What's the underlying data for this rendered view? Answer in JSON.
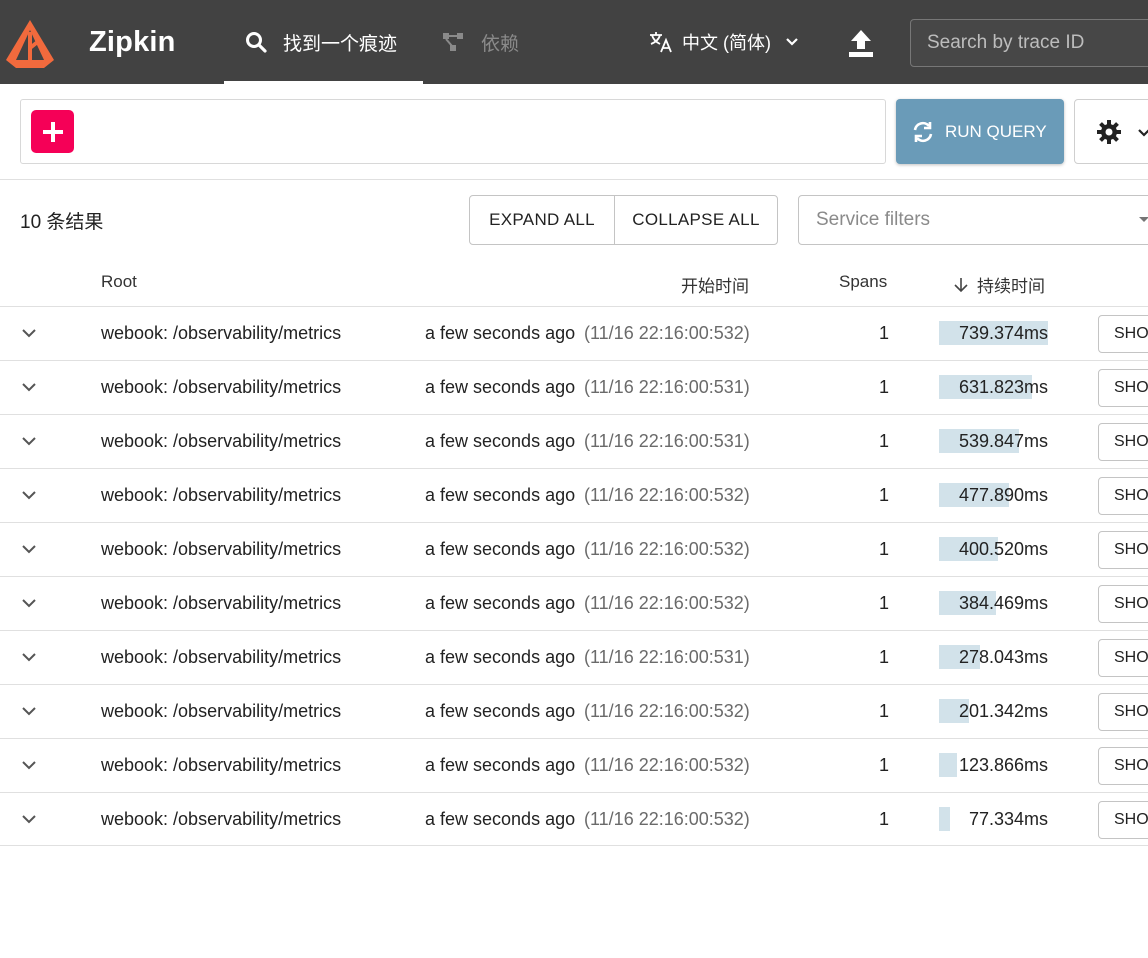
{
  "app": {
    "name": "Zipkin",
    "logo_icon": "zipkin-logo-icon"
  },
  "nav": {
    "tabs": [
      {
        "label": "找到一个痕迹",
        "icon": "search-icon",
        "active": true
      },
      {
        "label": "依赖",
        "icon": "dependencies-icon",
        "active": false
      }
    ],
    "language": {
      "label": "中文 (简体)",
      "icon": "translate-icon"
    },
    "upload_icon": "upload-icon",
    "search": {
      "placeholder": "Search by trace ID",
      "value": ""
    }
  },
  "query": {
    "add_icon": "plus-icon",
    "run_label": "RUN QUERY",
    "run_icon": "refresh-icon",
    "settings_icon": "gear-icon"
  },
  "results": {
    "count_label": "10 条结果",
    "expand_all": "EXPAND ALL",
    "collapse_all": "COLLAPSE ALL",
    "service_filter_placeholder": "Service filters"
  },
  "table": {
    "headers": {
      "root": "Root",
      "start_time": "开始时间",
      "spans": "Spans",
      "duration": "持续时间"
    },
    "sort_icon": "arrow-down-icon",
    "show_label": "SHOW",
    "rows": [
      {
        "root": "webook: /observability/metrics",
        "relative": "a few seconds ago",
        "absolute": "(11/16 22:16:00:532)",
        "spans": "1",
        "duration": "739.374ms",
        "duration_ms": 739.374
      },
      {
        "root": "webook: /observability/metrics",
        "relative": "a few seconds ago",
        "absolute": "(11/16 22:16:00:531)",
        "spans": "1",
        "duration": "631.823ms",
        "duration_ms": 631.823
      },
      {
        "root": "webook: /observability/metrics",
        "relative": "a few seconds ago",
        "absolute": "(11/16 22:16:00:531)",
        "spans": "1",
        "duration": "539.847ms",
        "duration_ms": 539.847
      },
      {
        "root": "webook: /observability/metrics",
        "relative": "a few seconds ago",
        "absolute": "(11/16 22:16:00:532)",
        "spans": "1",
        "duration": "477.890ms",
        "duration_ms": 477.89
      },
      {
        "root": "webook: /observability/metrics",
        "relative": "a few seconds ago",
        "absolute": "(11/16 22:16:00:532)",
        "spans": "1",
        "duration": "400.520ms",
        "duration_ms": 400.52
      },
      {
        "root": "webook: /observability/metrics",
        "relative": "a few seconds ago",
        "absolute": "(11/16 22:16:00:532)",
        "spans": "1",
        "duration": "384.469ms",
        "duration_ms": 384.469
      },
      {
        "root": "webook: /observability/metrics",
        "relative": "a few seconds ago",
        "absolute": "(11/16 22:16:00:531)",
        "spans": "1",
        "duration": "278.043ms",
        "duration_ms": 278.043
      },
      {
        "root": "webook: /observability/metrics",
        "relative": "a few seconds ago",
        "absolute": "(11/16 22:16:00:532)",
        "spans": "1",
        "duration": "201.342ms",
        "duration_ms": 201.342
      },
      {
        "root": "webook: /observability/metrics",
        "relative": "a few seconds ago",
        "absolute": "(11/16 22:16:00:532)",
        "spans": "1",
        "duration": "123.866ms",
        "duration_ms": 123.866
      },
      {
        "root": "webook: /observability/metrics",
        "relative": "a few seconds ago",
        "absolute": "(11/16 22:16:00:532)",
        "spans": "1",
        "duration": "77.334ms",
        "duration_ms": 77.334
      }
    ]
  },
  "colors": {
    "topbar": "#424242",
    "add_button": "#f50057",
    "run_button": "#6a9bb8",
    "duration_bar": "#d2e2ea"
  }
}
